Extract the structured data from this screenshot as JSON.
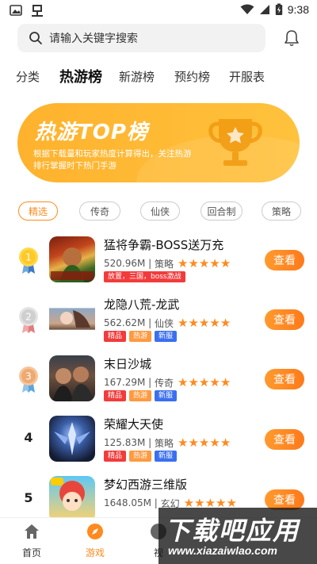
{
  "status_bar": {
    "time": "9:38"
  },
  "search": {
    "placeholder": "请输入关键字搜索"
  },
  "tabs": [
    {
      "label": "分类"
    },
    {
      "label": "热游榜",
      "active": true
    },
    {
      "label": "新游榜"
    },
    {
      "label": "预约榜"
    },
    {
      "label": "开服表"
    }
  ],
  "banner": {
    "title": "热游TOP榜",
    "description": "根据下载量和玩家热度计算得出，关注热游排行掌握时下热门手游"
  },
  "filters": [
    {
      "label": "精选",
      "active": true
    },
    {
      "label": "传奇"
    },
    {
      "label": "仙侠"
    },
    {
      "label": "回合制"
    },
    {
      "label": "策略"
    }
  ],
  "games": [
    {
      "rank": "1",
      "name": "猛将争霸-BOSS送万充",
      "size": "520.96M",
      "category": "策略",
      "stars": 5,
      "tags": [
        {
          "text": "放置，三国，boss激战",
          "color": "red"
        }
      ],
      "button": "查看"
    },
    {
      "rank": "2",
      "name": "龙隐八荒-龙武",
      "size": "562.62M",
      "category": "仙侠",
      "stars": 5,
      "tags": [
        {
          "text": "精品",
          "color": "red"
        },
        {
          "text": "热游",
          "color": "orange"
        },
        {
          "text": "新服",
          "color": "blue"
        }
      ],
      "button": "查看"
    },
    {
      "rank": "3",
      "name": "末日沙城",
      "size": "167.29M",
      "category": "传奇",
      "stars": 5,
      "tags": [
        {
          "text": "精品",
          "color": "red"
        },
        {
          "text": "热游",
          "color": "orange"
        },
        {
          "text": "新服",
          "color": "blue"
        }
      ],
      "button": "查看"
    },
    {
      "rank": "4",
      "name": "荣耀大天使",
      "size": "125.83M",
      "category": "策略",
      "stars": 5,
      "tags": [
        {
          "text": "精品",
          "color": "red"
        },
        {
          "text": "热游",
          "color": "orange"
        },
        {
          "text": "新服",
          "color": "blue"
        }
      ],
      "button": "查看"
    },
    {
      "rank": "5",
      "name": "梦幻西游三维版",
      "size": "1648.05M",
      "category": "玄幻",
      "stars": 5,
      "tags": [],
      "button": "查看"
    }
  ],
  "bottom_nav": [
    {
      "label": "首页"
    },
    {
      "label": "游戏",
      "active": true
    },
    {
      "label": "视"
    }
  ],
  "watermark": {
    "main": "下载吧应用",
    "url": "www.xiazaiwlao.com"
  },
  "colors": {
    "accent": "#ff8a1f",
    "banner": "#ffb22e"
  }
}
